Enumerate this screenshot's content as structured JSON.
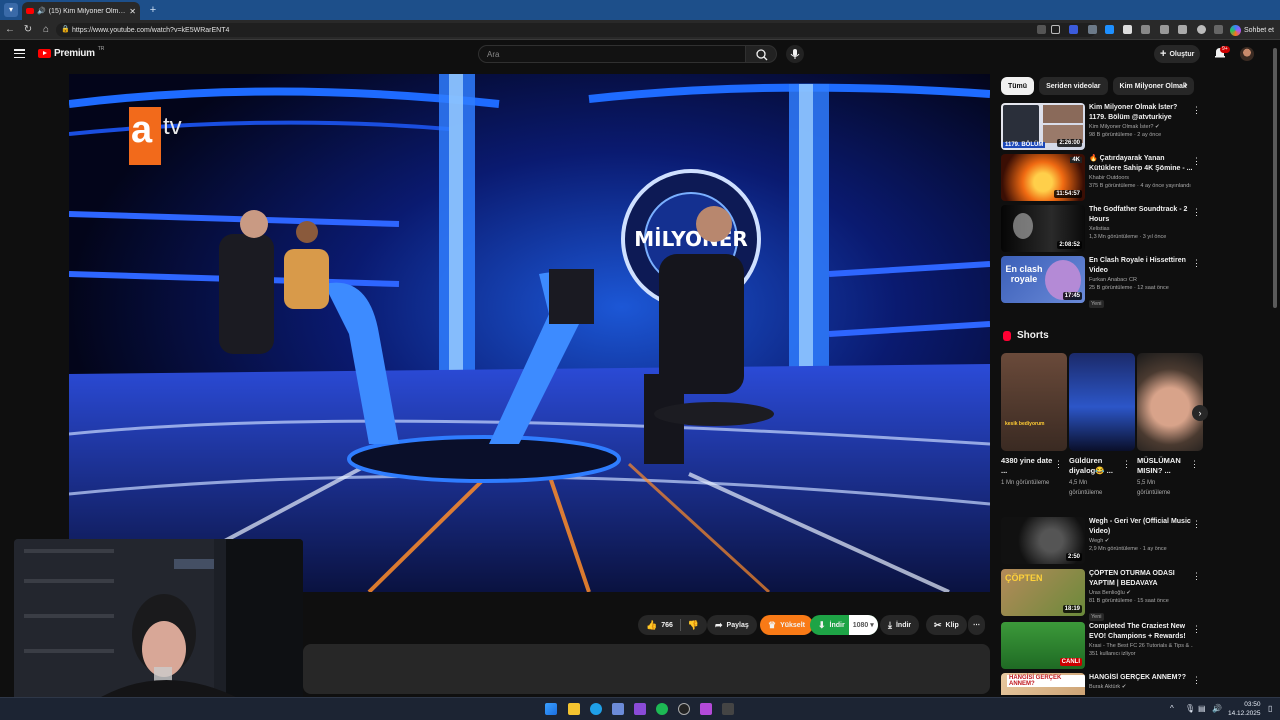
{
  "browser": {
    "tab_title": "(15) Kim Milyoner Olmak İster?",
    "close": "✕",
    "new_tab": "+",
    "url": "https://www.youtube.com/watch?v=kE5WRarENT4",
    "chat_label": "Sohbet et"
  },
  "header": {
    "logo_text": "Premium",
    "logo_cc": "TR",
    "search_placeholder": "Ara",
    "create_label": "Oluştur",
    "notif_count": "9+"
  },
  "actions": {
    "like_count": "766",
    "share": "Paylaş",
    "upgrade": "Yükselt",
    "download_premium": "İndir",
    "quality": "1080",
    "download": "İndir",
    "clip": "Klip",
    "more": "⋯"
  },
  "chips": [
    "Tümü",
    "Seriden videolar",
    "Kim Milyoner Olmak"
  ],
  "recommendations": [
    {
      "title": "Kim Milyoner Olmak İster? 1179. Bölüm @atvturkiye",
      "channel": "Kim Milyoner Olmak İster? ✔",
      "views": "98 B görüntüleme · 2 ay önce",
      "duration": "2:26:00",
      "badge": "",
      "thumb_text": "1179. BÖLÜM"
    },
    {
      "title": "🔥 Çatırdayarak Yanan Kütüklere Sahip 4K Şömine - ...",
      "channel": "Khabir Outdoors",
      "views": "375 B görüntüleme · 4 ay önce yayınlandı",
      "duration": "11:54:57",
      "badge": "",
      "thumb_text": "4K"
    },
    {
      "title": "The Godfather Soundtrack - 2 Hours",
      "channel": "Xelistias",
      "views": "1,3 Mn görüntüleme · 3 yıl önce",
      "duration": "2:08:52",
      "badge": "",
      "thumb_text": ""
    },
    {
      "title": "En Clash Royale i Hissettiren Video",
      "channel": "Furkan Anabacı CR",
      "views": "25 B görüntüleme · 12 saat önce",
      "duration": "17:45",
      "badge": "Yeni",
      "thumb_text": "En clash royale"
    },
    {
      "title": "Wegh - Geri Ver (Official Music Video)",
      "channel": "Wegh ✔",
      "views": "2,9 Mn görüntüleme · 1 ay önce",
      "duration": "2:50",
      "badge": "",
      "thumb_text": ""
    },
    {
      "title": "ÇÖPTEN OTURMA ODASI YAPTIM | BEDAVAYA",
      "channel": "Uras Benlioğlu ✔",
      "views": "81 B görüntüleme · 15 saat önce",
      "duration": "18:19",
      "badge": "Yeni",
      "thumb_text": "ÇÖPTEN"
    },
    {
      "title": "Completed The Craziest New EVO! Champions + Rewards!",
      "channel": "Krasi - The Best FC 26 Tutorials & Tips & ...",
      "views": "351 kullanıcı izliyor",
      "duration": "CANLI",
      "badge": "",
      "thumb_text": ""
    },
    {
      "title": "HANGİSİ GERÇEK ANNEM??",
      "channel": "Burak Aktürk ✔",
      "views": "",
      "duration": "",
      "badge": "",
      "thumb_text": "HANGİSİ GERÇEK ANNEM?"
    }
  ],
  "shorts": {
    "heading": "Shorts",
    "items": [
      {
        "title": "4380 yine date ...",
        "views": "1 Mn görüntüleme",
        "thumb_text": "kesik bediyorum"
      },
      {
        "title": "Güldüren diyalog😂 ...",
        "views": "4,5 Mn görüntüleme",
        "thumb_text": ""
      },
      {
        "title": "MÜSLÜMAN MISIN? ...",
        "views": "5,5 Mn görüntüleme",
        "thumb_text": ""
      }
    ]
  },
  "video": {
    "channel_logo": "atv",
    "logo_a": "a",
    "logo_tv": "tv"
  },
  "taskbar": {
    "time": "03:50",
    "date": "14.12.2025"
  },
  "colors": {
    "accent": "#ff0000",
    "upgrade": "#f97a16",
    "download": "#1ea446",
    "taskbar": "#1c2433"
  }
}
